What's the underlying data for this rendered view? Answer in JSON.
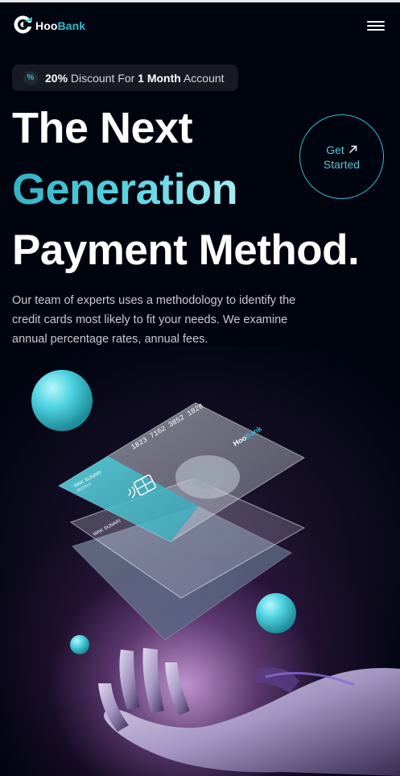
{
  "navbar": {
    "logo_part1": "Hoo",
    "logo_part2": "Bank",
    "menu_icon": "hamburger-menu-icon"
  },
  "badge": {
    "icon_symbol": "%",
    "highlight1": "20%",
    "text1": " Discount For ",
    "highlight2": "1 Month",
    "text2": " Account"
  },
  "hero": {
    "line1": "The Next",
    "line2": "Generation",
    "line3": "Payment Method."
  },
  "cta": {
    "line1": "Get",
    "line2": "Started",
    "icon": "arrow-up-right-icon"
  },
  "description": "Our team of experts uses a methodology to identify the credit cards most likely to fit your needs. We examine annual percentage rates, annual fees.",
  "illustration": {
    "card_number": "1823 7162 3852 1028",
    "card_brand_part1": "Hoo",
    "card_brand_part2": "Bank",
    "card_holder": "WAK SUNARI",
    "card_holder_sub": "9823314"
  },
  "colors": {
    "background": "#00040f",
    "accent": "#33bbcf",
    "badge_bg": "#171a22"
  }
}
